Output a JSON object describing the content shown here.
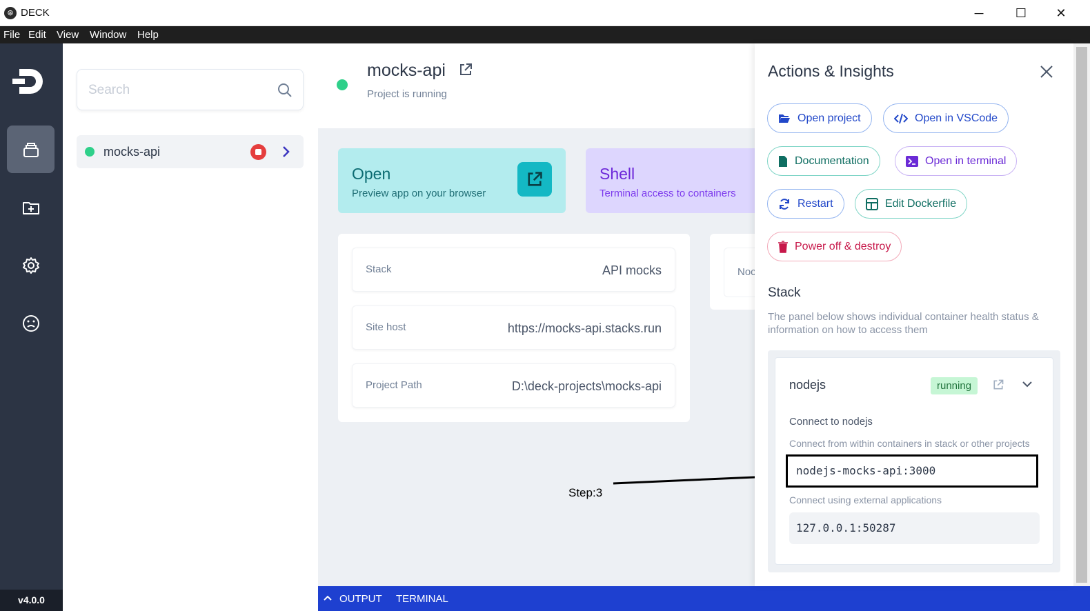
{
  "window": {
    "title": "DECK",
    "app_icon": "deck-logo-icon"
  },
  "menubar": {
    "items": [
      "File",
      "Edit",
      "View",
      "Window",
      "Help"
    ]
  },
  "rail": {
    "version": "v4.0.0"
  },
  "search": {
    "placeholder": "Search"
  },
  "projects": [
    {
      "name": "mocks-api",
      "status": "running"
    }
  ],
  "project": {
    "name": "mocks-api",
    "status_text": "Project is running",
    "cards": {
      "open_title": "Open",
      "open_sub": "Preview app on your browser",
      "shell_title": "Shell",
      "shell_sub": "Terminal access to containers",
      "partial_label": "Noc"
    },
    "info": [
      {
        "label": "Stack",
        "value": "API mocks"
      },
      {
        "label": "Site host",
        "value": "https://mocks-api.stacks.run"
      },
      {
        "label": "Project Path",
        "value": "D:\\deck-projects\\mocks-api"
      }
    ]
  },
  "drawer": {
    "title": "Actions & Insights",
    "actions": {
      "open_project": "Open project",
      "open_vscode": "Open in VSCode",
      "documentation": "Documentation",
      "open_terminal": "Open in terminal",
      "restart": "Restart",
      "edit_dockerfile": "Edit Dockerfile",
      "power_off": "Power off & destroy"
    },
    "stack_heading": "Stack",
    "stack_desc": "The panel below shows individual container health status & information on how to access them",
    "container": {
      "name": "nodejs",
      "badge": "running",
      "connect_heading": "Connect to nodejs",
      "internal_label": "Connect from within containers in stack or other projects",
      "internal_value": "nodejs-mocks-api:3000",
      "external_label": "Connect using external applications",
      "external_value": "127.0.0.1:50287"
    }
  },
  "annotation": {
    "label": "Step:3"
  },
  "bottombar": {
    "output": "OUTPUT",
    "terminal": "TERMINAL"
  },
  "colors": {
    "running_green": "#2fd08a",
    "accent_blue": "#1e40d0",
    "rail": "#2c3444"
  }
}
